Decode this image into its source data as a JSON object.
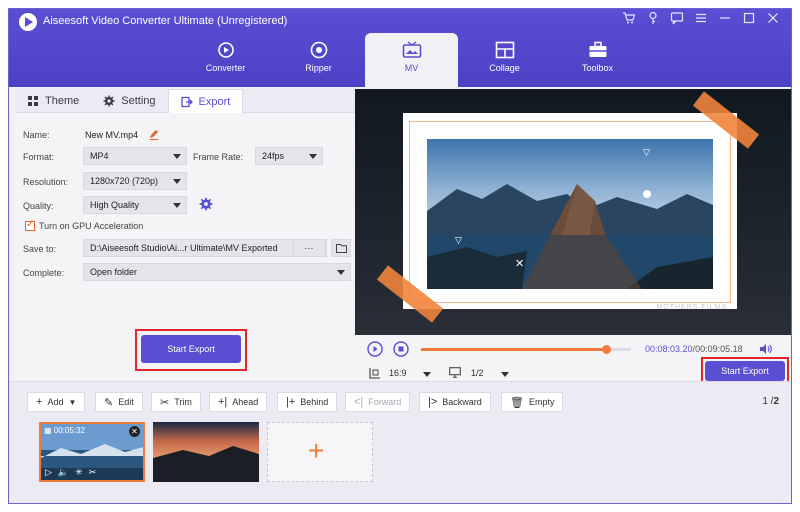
{
  "app": {
    "title": "Aiseesoft Video Converter Ultimate (Unregistered)"
  },
  "nav": {
    "tabs": [
      {
        "label": "Converter",
        "icon": "converter-icon"
      },
      {
        "label": "Ripper",
        "icon": "ripper-icon"
      },
      {
        "label": "MV",
        "icon": "mv-icon",
        "active": true
      },
      {
        "label": "Collage",
        "icon": "collage-icon"
      },
      {
        "label": "Toolbox",
        "icon": "toolbox-icon"
      }
    ]
  },
  "subtabs": [
    {
      "label": "Theme",
      "icon": "theme-icon"
    },
    {
      "label": "Setting",
      "icon": "gear-icon"
    },
    {
      "label": "Export",
      "icon": "export-icon",
      "active": true
    }
  ],
  "export": {
    "name_label": "Name:",
    "name_value": "New MV.mp4",
    "format_label": "Format:",
    "format_value": "MP4",
    "frame_rate_label": "Frame Rate:",
    "frame_rate_value": "24fps",
    "resolution_label": "Resolution:",
    "resolution_value": "1280x720 (720p)",
    "quality_label": "Quality:",
    "quality_value": "High Quality",
    "gpu_label": "Turn on GPU Acceleration",
    "gpu_checked": true,
    "save_to_label": "Save to:",
    "save_to_value": "D:\\Aiseesoft Studio\\Ai...r Ultimate\\MV Exported",
    "save_to_more": "···",
    "complete_label": "Complete:",
    "complete_value": "Open folder",
    "start_export_label": "Start Export"
  },
  "preview": {
    "watermark": "MOTHERS FILMS",
    "time_current": "00:08:03.20",
    "time_total": "00:09:05.18",
    "progress": 0.88,
    "aspect": "16:9",
    "page": "1/2",
    "start_export_label": "Start Export"
  },
  "toolbar": {
    "add": "Add",
    "edit": "Edit",
    "trim": "Trim",
    "ahead": "Ahead",
    "behind": "Behind",
    "forward": "Forward",
    "backward": "Backward",
    "empty": "Empty",
    "page_current": "1",
    "page_total": "2"
  },
  "media": {
    "clip1_duration": "00:05:32"
  },
  "colors": {
    "accent": "#5a4fd2",
    "highlight": "#e0262b",
    "orange": "#f07a3a"
  }
}
